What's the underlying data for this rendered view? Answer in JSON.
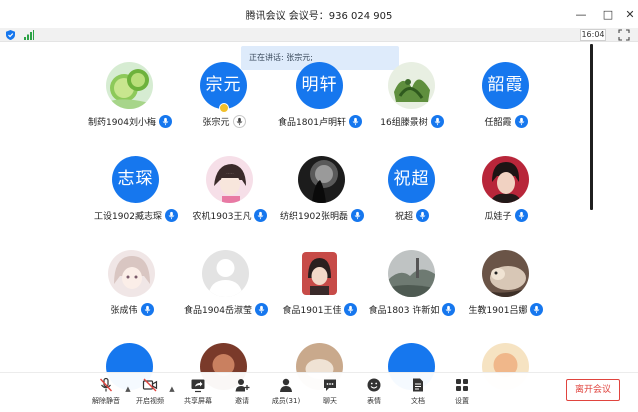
{
  "window": {
    "title": "腾讯会议 会议号：936 024 905"
  },
  "statusbar": {
    "time": "16:04"
  },
  "banner": {
    "text": "正在讲话: 张宗元;"
  },
  "participants": [
    {
      "name": "制药1904刘小梅",
      "avatar_text": ""
    },
    {
      "name": "张宗元",
      "avatar_text": "宗元"
    },
    {
      "name": "食品1801卢明轩",
      "avatar_text": "明轩"
    },
    {
      "name": "16组滕景树",
      "avatar_text": ""
    },
    {
      "name": "任韶霞",
      "avatar_text": "韶霞"
    },
    {
      "name": "工设1902臧志琛",
      "avatar_text": "志琛"
    },
    {
      "name": "农机1903王凡",
      "avatar_text": ""
    },
    {
      "name": "纺织1902张明磊",
      "avatar_text": ""
    },
    {
      "name": "祝超",
      "avatar_text": "祝超"
    },
    {
      "name": "瓜娃子",
      "avatar_text": ""
    },
    {
      "name": "张成伟",
      "avatar_text": ""
    },
    {
      "name": "食品1904岳淑莹",
      "avatar_text": ""
    },
    {
      "name": "食品1901王佳",
      "avatar_text": ""
    },
    {
      "name": "食品1803 许新如",
      "avatar_text": ""
    },
    {
      "name": "生教1901吕娜",
      "avatar_text": ""
    },
    {
      "name": "",
      "avatar_text": ""
    },
    {
      "name": "",
      "avatar_text": ""
    },
    {
      "name": "",
      "avatar_text": ""
    },
    {
      "name": "",
      "avatar_text": ""
    },
    {
      "name": "",
      "avatar_text": ""
    }
  ],
  "toolbar": {
    "mute": "解除静音",
    "video": "开启视频",
    "share": "共享屏幕",
    "invite": "邀请",
    "members": "成员(31)",
    "chat": "聊天",
    "reaction": "表情",
    "docs": "文档",
    "settings": "设置",
    "leave": "离开会议"
  },
  "colors": {
    "accent": "#1677ee",
    "leave": "#e0443e",
    "rail": "#1f1f1f"
  }
}
